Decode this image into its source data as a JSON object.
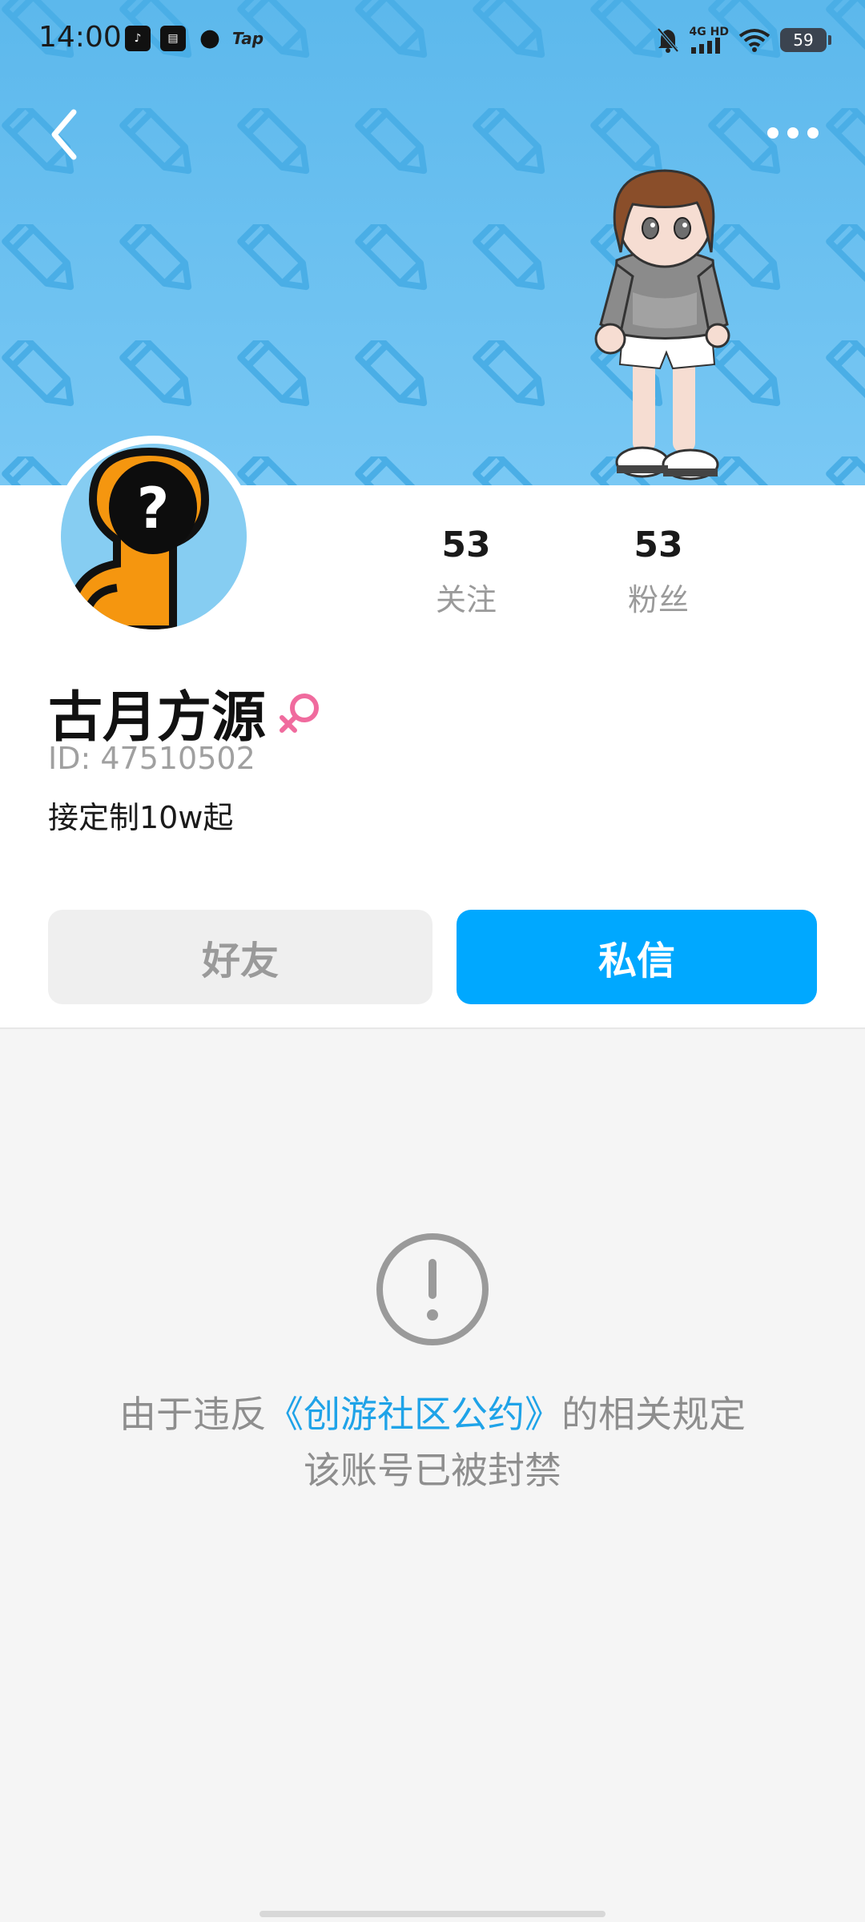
{
  "status_bar": {
    "time": "14:00",
    "app_icons": [
      "tiktok-icon",
      "news-icon",
      "chat-icon"
    ],
    "tap_label": "Tap",
    "network": "4G HD",
    "battery": "59"
  },
  "header": {
    "back_icon": "chevron-left-icon",
    "more_icon": "more-dots-icon"
  },
  "profile": {
    "following_count": "53",
    "following_label": "关注",
    "fans_count": "53",
    "fans_label": "粉丝",
    "username": "古月方源",
    "gender_icon": "female-icon",
    "user_id": "ID: 47510502",
    "bio": "接定制10w起"
  },
  "actions": {
    "friend_label": "好友",
    "message_label": "私信"
  },
  "ban_notice": {
    "prefix": "由于违反",
    "link": "《创游社区公约》",
    "suffix": "的相关规定",
    "line2": "该账号已被封禁"
  },
  "colors": {
    "banner": "#79c8f4",
    "accent": "#00a8ff",
    "link": "#1fa3e8",
    "female": "#f06b9e"
  }
}
